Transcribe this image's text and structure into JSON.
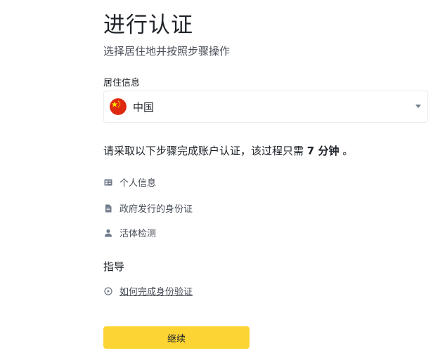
{
  "header": {
    "title": "进行认证",
    "subtitle": "选择居住地并按照步骤操作"
  },
  "residence": {
    "label": "居住信息",
    "selected_value": "中国",
    "flag_icon": "china-flag-icon",
    "dropdown_icon": "caret-down-icon"
  },
  "instruction": {
    "prefix": "请采取以下步骤完成账户认证，该过程只需 ",
    "time": "7 分钟",
    "suffix": " 。"
  },
  "steps": [
    {
      "icon": "id-card-icon",
      "label": "个人信息"
    },
    {
      "icon": "document-icon",
      "label": "政府发行的身份证"
    },
    {
      "icon": "person-icon",
      "label": "活体检测"
    }
  ],
  "guide": {
    "heading": "指导",
    "link_icon": "play-circle-icon",
    "link_label": "如何完成身份验证"
  },
  "actions": {
    "continue_label": "继续"
  },
  "colors": {
    "primary_button": "#fcd535",
    "text_primary": "#1e2329",
    "text_secondary": "#474d57",
    "icon_gray": "#707a8a",
    "border": "#eaecef",
    "flag_red": "#de2910",
    "flag_star": "#ffde00"
  }
}
